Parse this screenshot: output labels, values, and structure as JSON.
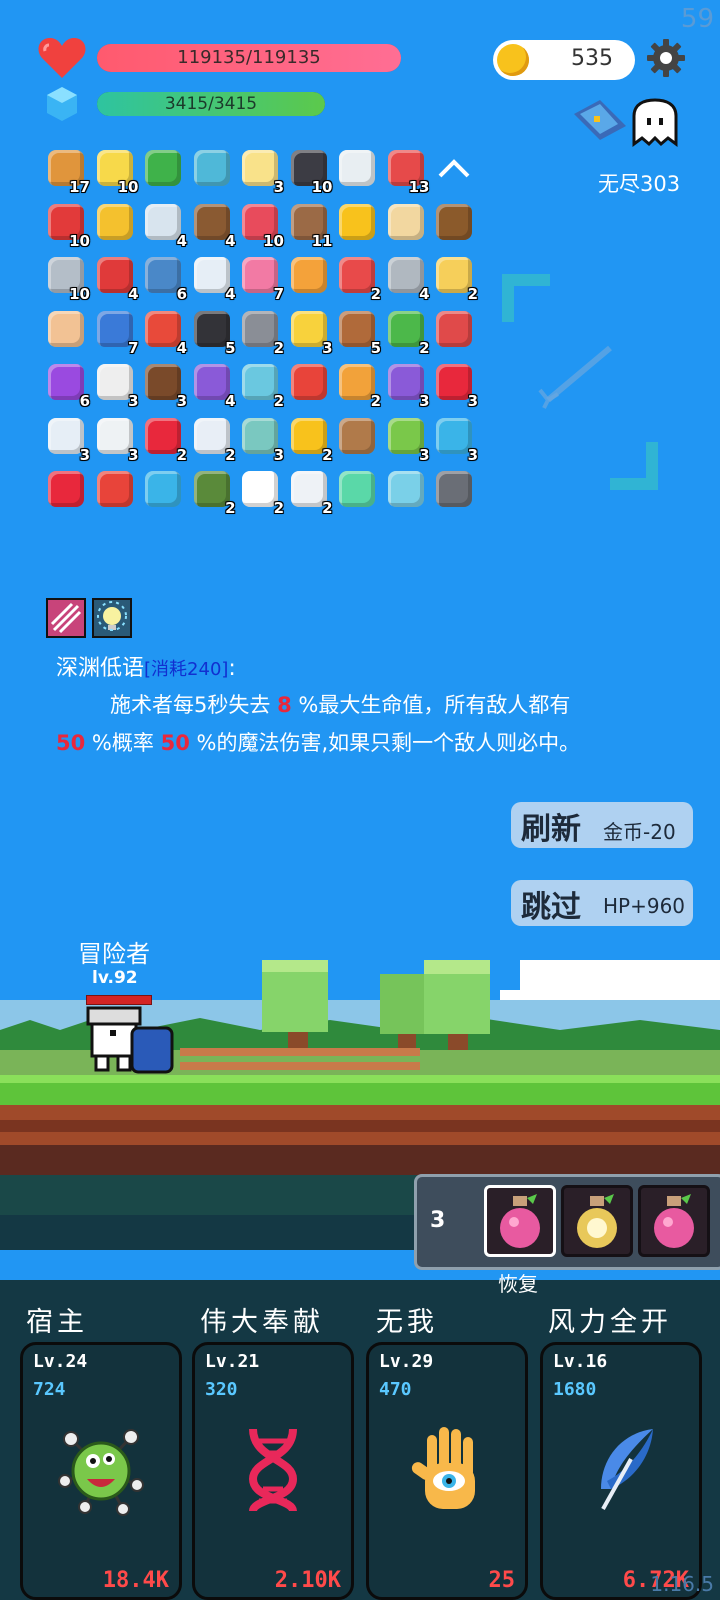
{
  "status": {
    "fps": "59",
    "hp_text": "119135/119135",
    "hp_fraction": 1.0,
    "mp_text": "3415/3415",
    "mp_fraction": 1.0,
    "coins": "535",
    "mode": "无尽303",
    "version": "1.16.5"
  },
  "items": [
    {
      "icon": "book-icon",
      "count": "17",
      "color": "#e0953c"
    },
    {
      "icon": "flower-icon",
      "count": "10",
      "color": "#f7d94a"
    },
    {
      "icon": "green-card-icon",
      "count": "",
      "color": "#3fb24a"
    },
    {
      "icon": "magnifier-icon",
      "count": "",
      "color": "#4fb8d8"
    },
    {
      "icon": "fried-egg-icon",
      "count": "3",
      "color": "#f9e28a"
    },
    {
      "icon": "bat-icon",
      "count": "10",
      "color": "#3c3c44"
    },
    {
      "icon": "checklist-icon",
      "count": "",
      "color": "#e8eef2"
    },
    {
      "icon": "watermelon-icon",
      "count": "13",
      "color": "#e64a4a"
    },
    {
      "icon": "collapse-arrow-icon",
      "count": "",
      "color": "#ffffff"
    },
    {
      "icon": "apple-icon",
      "count": "10",
      "color": "#e23a3a"
    },
    {
      "icon": "molecule-icon",
      "count": "",
      "color": "#f4c12e"
    },
    {
      "icon": "clipboard-icon",
      "count": "4",
      "color": "#d8e4ee"
    },
    {
      "icon": "coconut-icon",
      "count": "4",
      "color": "#8a5a32"
    },
    {
      "icon": "jam-jar-icon",
      "count": "10",
      "color": "#e84b5c"
    },
    {
      "icon": "door-icon",
      "count": "11",
      "color": "#9b6a46"
    },
    {
      "icon": "sun-icon",
      "count": "",
      "color": "#f8c21c"
    },
    {
      "icon": "treasure-map-icon",
      "count": "",
      "color": "#f2d7a0"
    },
    {
      "icon": "treasure-chest-icon",
      "count": "",
      "color": "#8b5a2b"
    },
    {
      "icon": "sword-icon",
      "count": "10",
      "color": "#b4bec8"
    },
    {
      "icon": "mushroom-icon",
      "count": "4",
      "color": "#e03a3a"
    },
    {
      "icon": "shield-icon",
      "count": "6",
      "color": "#4a88c8"
    },
    {
      "icon": "envelope-icon",
      "count": "4",
      "color": "#e6eef6"
    },
    {
      "icon": "spray-bottle-icon",
      "count": "7",
      "color": "#f27aa4"
    },
    {
      "icon": "recipe-book-icon",
      "count": "",
      "color": "#f4a23a"
    },
    {
      "icon": "pill-icon",
      "count": "2",
      "color": "#e84a4a"
    },
    {
      "icon": "battle-axe-icon",
      "count": "4",
      "color": "#b0b8c0"
    },
    {
      "icon": "note-pencil-icon",
      "count": "2",
      "color": "#f6cf5a"
    },
    {
      "icon": "fist-icon",
      "count": "",
      "color": "#f2c294"
    },
    {
      "icon": "star-card-icon",
      "count": "7",
      "color": "#3a7ad8"
    },
    {
      "icon": "sock-icon",
      "count": "4",
      "color": "#e84a3a"
    },
    {
      "icon": "cauldron-icon",
      "count": "5",
      "color": "#333338"
    },
    {
      "icon": "spiked-ball-icon",
      "count": "2",
      "color": "#8a8e96"
    },
    {
      "icon": "magic-wand-icon",
      "count": "3",
      "color": "#f8d23c"
    },
    {
      "icon": "round-shield-icon",
      "count": "5",
      "color": "#b06a3a"
    },
    {
      "icon": "green-monster-icon",
      "count": "2",
      "color": "#4cb84a"
    },
    {
      "icon": "red-shield-icon",
      "count": "",
      "color": "#e04a4a"
    },
    {
      "icon": "crystal-ball-icon",
      "count": "6",
      "color": "#9a4ae0"
    },
    {
      "icon": "dice-icon",
      "count": "3",
      "color": "#eeeeee"
    },
    {
      "icon": "coconut-half-icon",
      "count": "3",
      "color": "#7a4a2a"
    },
    {
      "icon": "purple-badge-icon",
      "count": "4",
      "color": "#8a5ad8"
    },
    {
      "icon": "potion-flask-icon",
      "count": "2",
      "color": "#6ac8e0"
    },
    {
      "icon": "gift-box-icon",
      "count": "",
      "color": "#e8443a"
    },
    {
      "icon": "meteor-icon",
      "count": "2",
      "color": "#f2a23a"
    },
    {
      "icon": "purple-chest-icon",
      "count": "3",
      "color": "#8a5ad8"
    },
    {
      "icon": "heart-icon",
      "count": "3",
      "color": "#e8283c"
    },
    {
      "icon": "capsule-icon",
      "count": "3",
      "color": "#e6eef6"
    },
    {
      "icon": "light-bulb-icon",
      "count": "3",
      "color": "#eef2f4"
    },
    {
      "icon": "hearts-icon",
      "count": "2",
      "color": "#e8283c"
    },
    {
      "icon": "angel-wings-icon",
      "count": "2",
      "color": "#e8eef6"
    },
    {
      "icon": "target-disc-icon",
      "count": "3",
      "color": "#7ac8c0"
    },
    {
      "icon": "ring-icon",
      "count": "2",
      "color": "#f8c21c"
    },
    {
      "icon": "crossbow-icon",
      "count": "",
      "color": "#b07a4a"
    },
    {
      "icon": "lime-icon",
      "count": "3",
      "color": "#7ac84a"
    },
    {
      "icon": "chat-bubble-icon",
      "count": "3",
      "color": "#3ab4e8"
    },
    {
      "icon": "strawberry-icon",
      "count": "",
      "color": "#e8283c"
    },
    {
      "icon": "thermometer-icon",
      "count": "",
      "color": "#e8443a"
    },
    {
      "icon": "crosshair-icon",
      "count": "",
      "color": "#3ab4e8"
    },
    {
      "icon": "grenade-icon",
      "count": "2",
      "color": "#5a8a3a"
    },
    {
      "icon": "ghost-icon",
      "count": "2",
      "color": "#ffffff"
    },
    {
      "icon": "cloud-icon",
      "count": "2",
      "color": "#eef2f6"
    },
    {
      "icon": "spirit-icon",
      "count": "",
      "color": "#5ad8a8"
    },
    {
      "icon": "scroll-icon",
      "count": "",
      "color": "#7ad0e8"
    },
    {
      "icon": "compass-icon",
      "count": "",
      "color": "#6a6e76"
    }
  ],
  "buffs": [
    {
      "icon": "claw-slash-icon",
      "color": "#c8447a"
    },
    {
      "icon": "glow-bulb-icon",
      "color": "#5ac8e0"
    }
  ],
  "skill_info": {
    "name": "深渊低语",
    "cost": "[消耗240]",
    "colon": ":",
    "line1_a": "施术者每5秒失去",
    "line1_num": "8",
    "line1_b": "%最大生命值，所有敌人都有",
    "line2_num1": "50",
    "line2_a": "%概率",
    "line2_num2": "50",
    "line2_b": "%的魔法伤害,如果只剩一个敌人则必中。"
  },
  "actions": {
    "refresh_label": "刷新",
    "refresh_cost": "金币-20",
    "skip_label": "跳过",
    "skip_reward": "HP+960"
  },
  "player": {
    "name": "冒险者",
    "level": "lv.92"
  },
  "potions": {
    "count": "3",
    "label": "恢复",
    "slots": [
      {
        "icon": "pink-potion-icon",
        "color": "#e85aa0"
      },
      {
        "icon": "sparkle-potion-icon",
        "color": "#e8c85a"
      },
      {
        "icon": "pink-potion-icon",
        "color": "#e85aa0"
      }
    ]
  },
  "skills": [
    {
      "title": "宿主",
      "level": "Lv.24",
      "cost": "724",
      "value": "18.4K",
      "icon": "virus-monster-icon",
      "color": "#7ac84a"
    },
    {
      "title": "伟大奉献",
      "level": "Lv.21",
      "cost": "320",
      "value": "2.10K",
      "icon": "dna-icon",
      "color": "#e8285a"
    },
    {
      "title": "无我",
      "level": "Lv.29",
      "cost": "470",
      "value": "25",
      "icon": "hand-eye-icon",
      "color": "#f8b84a"
    },
    {
      "title": "风力全开",
      "level": "Lv.16",
      "cost": "1680",
      "value": "6.72K",
      "icon": "feather-icon",
      "color": "#4a8ae8"
    }
  ]
}
